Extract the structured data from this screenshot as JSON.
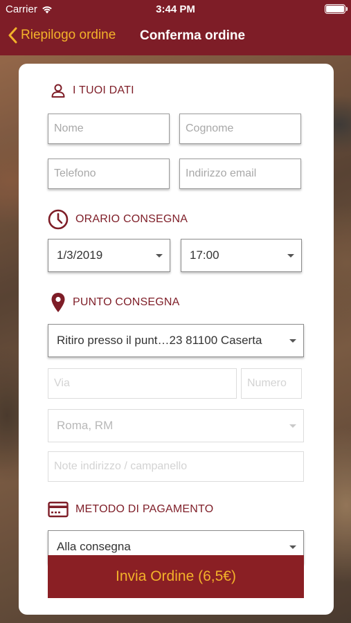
{
  "status": {
    "carrier": "Carrier",
    "time": "3:44 PM"
  },
  "nav": {
    "back_label": "Riepilogo ordine",
    "title": "Conferma ordine"
  },
  "sections": {
    "personal": "I TUOI DATI",
    "time": "ORARIO CONSEGNA",
    "place": "PUNTO CONSEGNA",
    "payment": "METODO DI PAGAMENTO"
  },
  "fields": {
    "nome": "Nome",
    "cognome": "Cognome",
    "telefono": "Telefono",
    "email": "Indirizzo email",
    "via": "Via",
    "numero": "Numero",
    "note": "Note indirizzo / campanello"
  },
  "selects": {
    "date": "1/3/2019",
    "hour": "17:00",
    "delivery_point": "Ritiro presso il punt…23 81100 Caserta",
    "city": "Roma, RM",
    "payment": "Alla consegna"
  },
  "submit_label": "Invia Ordine (6,5€)",
  "colors": {
    "brand": "#7e1d27",
    "accent": "#f3b22a",
    "button": "#8a1f24"
  }
}
